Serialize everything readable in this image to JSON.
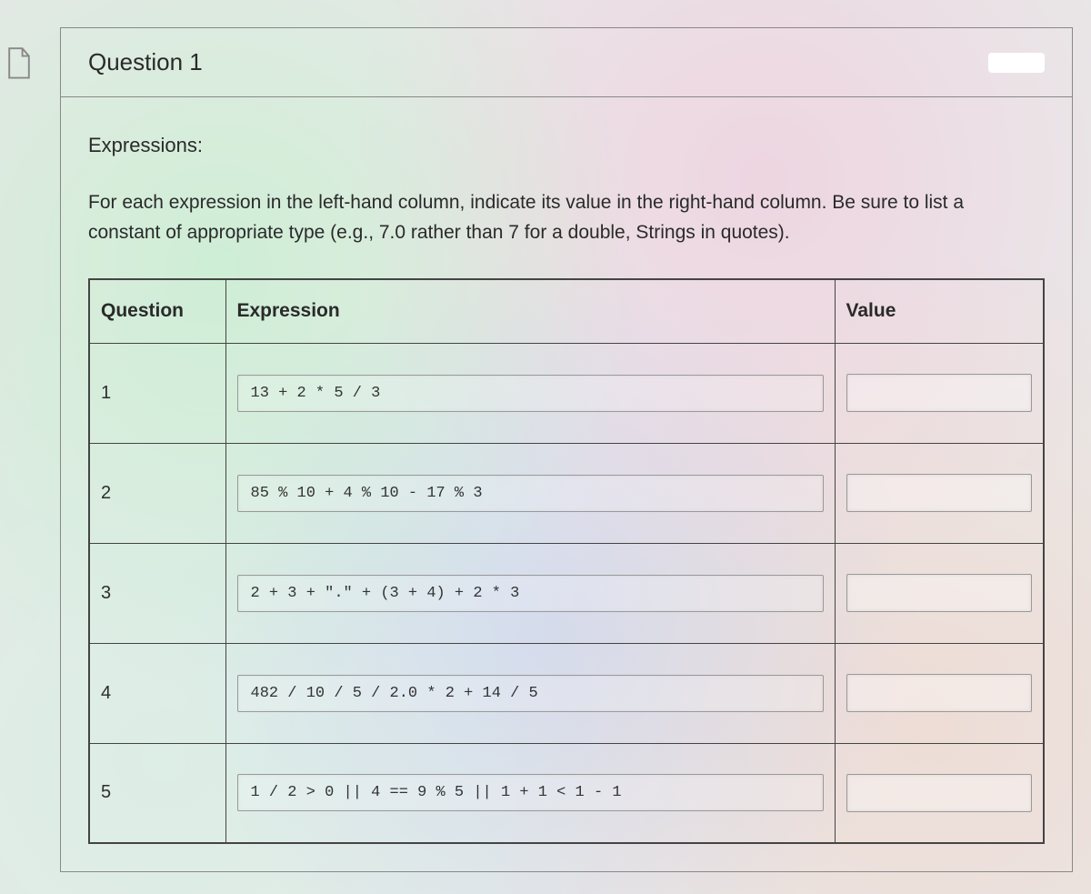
{
  "header": {
    "title": "Question 1"
  },
  "section_title": "Expressions:",
  "instructions": "For each expression in the left-hand column, indicate its value in the right-hand column.  Be sure to list a constant of appropriate type (e.g., 7.0 rather than 7 for a double, Strings in quotes).",
  "table": {
    "headers": {
      "question": "Question",
      "expression": "Expression",
      "value": "Value"
    },
    "rows": [
      {
        "num": "1",
        "expr": "13 + 2 * 5 / 3",
        "value": ""
      },
      {
        "num": "2",
        "expr": "85 % 10 + 4 % 10 - 17 % 3",
        "value": ""
      },
      {
        "num": "3",
        "expr": "2 + 3 + \".\" + (3 + 4) + 2 * 3",
        "value": ""
      },
      {
        "num": "4",
        "expr": "482 / 10 / 5 / 2.0 * 2 + 14 / 5",
        "value": ""
      },
      {
        "num": "5",
        "expr": "1 / 2 > 0 || 4 == 9 % 5 || 1 + 1 < 1 - 1",
        "value": ""
      }
    ]
  }
}
